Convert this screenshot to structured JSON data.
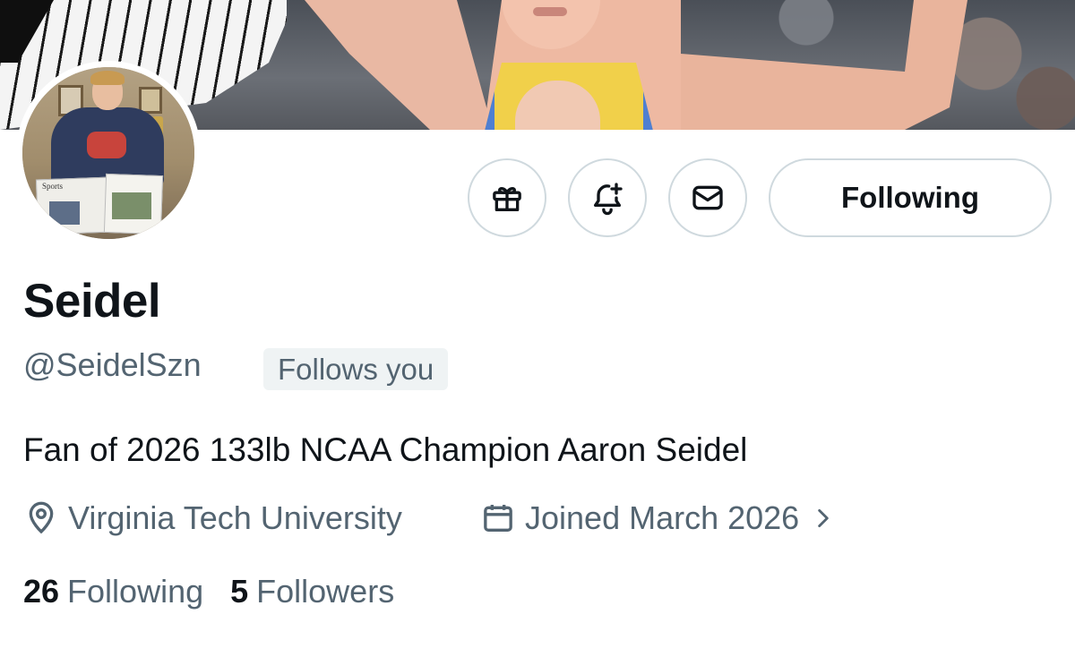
{
  "profile": {
    "name": "Seidel",
    "handle": "@SeidelSzn",
    "follows_you_badge": "Follows you",
    "bio": "Fan of 2026 133lb NCAA Champion Aaron Seidel",
    "location": "Virginia Tech University",
    "joined": "Joined March 2026",
    "following_count": "26",
    "following_label": "Following",
    "followers_count": "5",
    "followers_label": "Followers"
  },
  "actions": {
    "gift_icon": "gift-icon",
    "notify_icon": "bell-plus-icon",
    "message_icon": "envelope-icon",
    "follow_button_label": "Following"
  },
  "avatar_paper_text": "Sports",
  "colors": {
    "text_primary": "#0f1419",
    "text_secondary": "#536471",
    "border": "#cfd9de",
    "badge_bg": "#eff3f4"
  }
}
